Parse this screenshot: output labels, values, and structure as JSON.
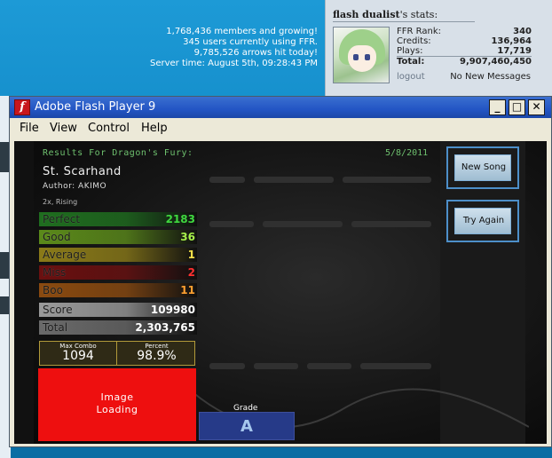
{
  "site": {
    "members_line": "1,768,436 members and growing!",
    "users_line": "345 users currently using FFR.",
    "arrows_line": "9,785,526 arrows hit today!",
    "server_time": "Server time: August 5th, 09:28:43 PM"
  },
  "user_panel": {
    "username": "flash dualist",
    "title_suffix": "'s stats:",
    "stats": [
      {
        "label": "FFR Rank:",
        "value": "340"
      },
      {
        "label": "Credits:",
        "value": "136,964"
      },
      {
        "label": "Plays:",
        "value": "17,719"
      },
      {
        "label": "Total:",
        "value": "9,907,460,450"
      }
    ],
    "logout": "logout",
    "messages": "No New Messages"
  },
  "window": {
    "title": "Adobe Flash Player 9",
    "icon_glyph": "f",
    "buttons": {
      "minimize": "_",
      "maximize": "□",
      "close": "✕"
    },
    "menu": [
      "File",
      "View",
      "Control",
      "Help"
    ]
  },
  "results": {
    "header": "Results For Dragon's Fury:",
    "date": "5/8/2011",
    "song_title": "St. Scarhand",
    "author": "Author: AKIMO",
    "mods": "2x, Rising",
    "judgements": [
      {
        "label": "Perfect",
        "value": "2183",
        "bar_color": "#1f6e1f",
        "value_color": "#3fd83f"
      },
      {
        "label": "Good",
        "value": "36",
        "bar_color": "#5b8a1a",
        "value_color": "#a6f04a"
      },
      {
        "label": "Average",
        "value": "1",
        "bar_color": "#8a7a18",
        "value_color": "#f4e04a"
      },
      {
        "label": "Miss",
        "value": "2",
        "bar_color": "#6a1010",
        "value_color": "#ff3030"
      },
      {
        "label": "Boo",
        "value": "11",
        "bar_color": "#8a4a10",
        "value_color": "#ffa030"
      },
      {
        "label": "Score",
        "value": "109980",
        "bar_color": "#9a9a9a",
        "value_color": "#ffffff"
      },
      {
        "label": "Total",
        "value": "2,303,765",
        "bar_color": "#6a6a6a",
        "value_color": "#ffffff"
      }
    ],
    "max_combo_label": "Max Combo",
    "max_combo": "1094",
    "percent_label": "Percent",
    "percent": "98.9%",
    "image_loading": [
      "Image",
      "Loading"
    ],
    "grade_label": "Grade",
    "grade": "A",
    "new_song_button": "New Song",
    "try_again_button": "Try Again"
  }
}
